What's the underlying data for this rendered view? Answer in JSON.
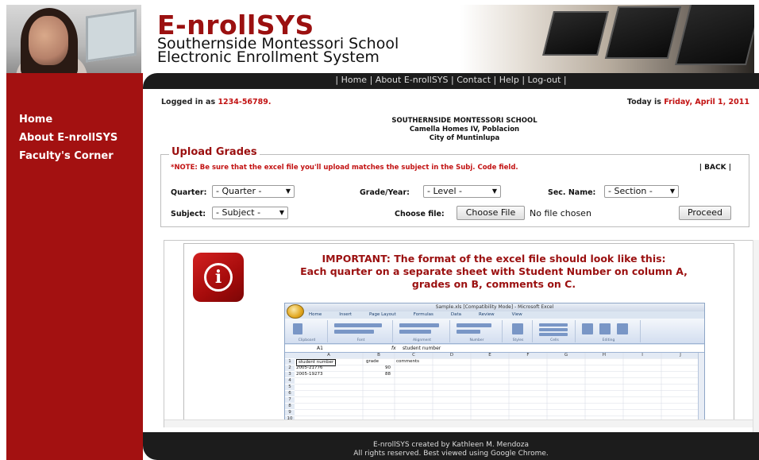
{
  "header": {
    "brand": "E-nrollSYS",
    "subtitle_line1": "Southernside Montessori School",
    "subtitle_line2": "Electronic Enrollment System"
  },
  "nav": {
    "sep": "|",
    "items": [
      "Home",
      "About E-nrollSYS",
      "Contact",
      "Help",
      "Log-out"
    ]
  },
  "sidebar": {
    "items": [
      "Home",
      "About E-nrollSYS",
      "Faculty's Corner"
    ]
  },
  "status": {
    "logged_prefix": "Logged in as ",
    "user_id": "1234-56789.",
    "today_prefix": "Today is ",
    "date": "Friday, April 1, 2011"
  },
  "school": {
    "name": "SOUTHERNSIDE MONTESSORI SCHOOL",
    "address1": "Camella Homes IV, Poblacion",
    "address2": "City of Muntinlupa"
  },
  "upload": {
    "legend": "Upload Grades",
    "note": "*NOTE: Be sure that the excel file you'll upload matches the subject in the Subj. Code field.",
    "back": "| BACK |",
    "quarter_label": "Quarter:",
    "quarter_value": "- Quarter -",
    "grade_label": "Grade/Year:",
    "grade_value": "- Level -",
    "section_label": "Sec. Name:",
    "section_value": "- Section -",
    "subject_label": "Subject:",
    "subject_value": "- Subject -",
    "file_label": "Choose file:",
    "file_button": "Choose File",
    "file_status": "No file chosen",
    "proceed": "Proceed"
  },
  "important": {
    "line1": "IMPORTANT: The format of the excel file should look like this:",
    "line2": "Each quarter on a separate sheet with Student Number on column A,",
    "line3": "grades on B, comments on C."
  },
  "excel": {
    "window_title": "Sample.xls [Compatibility Mode] - Microsoft Excel",
    "tabs": [
      "Home",
      "Insert",
      "Page Layout",
      "Formulas",
      "Data",
      "Review",
      "View"
    ],
    "ribbon_groups": [
      "Clipboard",
      "Font",
      "Alignment",
      "Number",
      "Styles",
      "Cells",
      "Editing"
    ],
    "name_box": "A1",
    "formula": "student number",
    "columns": [
      "A",
      "B",
      "C",
      "D",
      "E",
      "F",
      "G",
      "H",
      "I",
      "J"
    ],
    "rows": [
      "1",
      "2",
      "3",
      "4",
      "5",
      "6",
      "7",
      "8",
      "9",
      "10"
    ],
    "header_row": [
      "student number",
      "grade",
      "comments"
    ],
    "data_rows": [
      [
        "2005-21776",
        "90"
      ],
      [
        "2005-19273",
        "88"
      ]
    ]
  },
  "footer": {
    "line1": "E-nrollSYS created by Kathleen M. Mendoza",
    "line2": "All rights reserved. Best viewed using Google Chrome."
  },
  "colors": {
    "brand_red": "#9b1010",
    "sidebar_red": "#a31111",
    "note_red": "#c21212",
    "dark_bar": "#1c1c1c"
  }
}
